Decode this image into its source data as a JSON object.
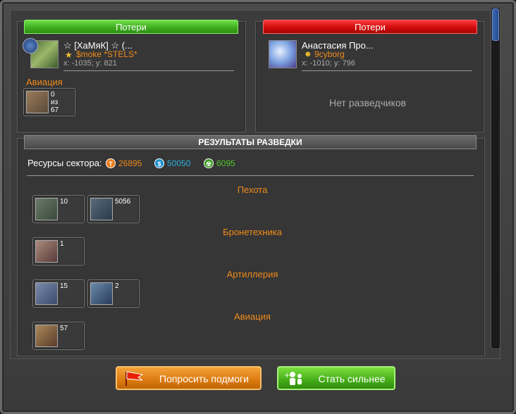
{
  "left_panel": {
    "loss_label": "Потери",
    "player_name": "☆ [ХаМяК] ☆ (...",
    "alliance": "$moke  *STELS*",
    "coords": "x: -1035; y: 821",
    "section_title": "Авиация",
    "units": [
      {
        "icon": "aircraft-icon",
        "count_line1": "0",
        "count_line2": "из",
        "count_line3": "67"
      }
    ]
  },
  "right_panel": {
    "loss_label": "Потери",
    "player_name": "Анастасия Про...",
    "alliance": "9cyborg",
    "coords": "x: -1010; y: 796",
    "no_scouts": "Нет разведчиков"
  },
  "results": {
    "header": "РЕЗУЛЬТАТЫ РАЗВЕДКИ",
    "resources_label": "Ресурсы сектора:",
    "titanium": "26895",
    "credits": "50050",
    "uranium": "6095",
    "titanium_icon": "T",
    "credits_icon": "$",
    "uranium_icon": "☢",
    "categories": {
      "infantry": "Пехота",
      "armor": "Бронетехника",
      "artillery": "Артиллерия",
      "aviation": "Авиация"
    },
    "infantry_units": [
      {
        "count": "10"
      },
      {
        "count": "5056"
      }
    ],
    "armor_units": [
      {
        "count": "1"
      }
    ],
    "artillery_units": [
      {
        "count": "15"
      },
      {
        "count": "2"
      }
    ],
    "aviation_units": [
      {
        "count": "57"
      }
    ]
  },
  "buttons": {
    "ask_help": "Попросить подмоги",
    "become_stronger": "Стать сильнее"
  },
  "colors": {
    "titanium": "#f08a1a",
    "credits": "#2ab0e0",
    "uranium": "#55c32a",
    "accent_orange": "#f08a1a"
  }
}
